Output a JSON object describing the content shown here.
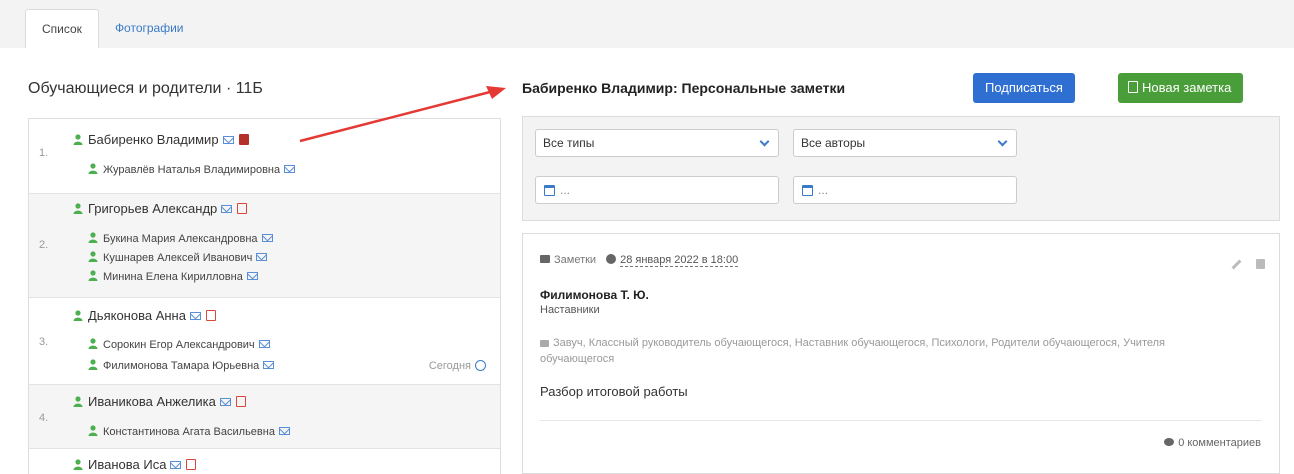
{
  "tabs": [
    {
      "label": "Список",
      "active": true
    },
    {
      "label": "Фотографии",
      "active": false
    }
  ],
  "left_title": "Обучающиеся и родители · 11Б",
  "right_title": "Бабиренко Владимир: Персональные заметки",
  "buttons": {
    "subscribe": "Подписаться",
    "new_note": "Новая заметка"
  },
  "students": [
    {
      "num": "1.",
      "name": "Бабиренко Владимир",
      "parents": [
        "Журавлёв Наталья Владимировна"
      ]
    },
    {
      "num": "2.",
      "name": "Григорьев Александр",
      "parents": [
        "Букина Мария Александровна",
        "Кушнарев Алексей Иванович",
        "Минина Елена Кирилловна"
      ]
    },
    {
      "num": "3.",
      "name": "Дьяконова Анна",
      "parents": [
        "Сорокин Егор Александрович",
        "Филимонова Тамара Юрьевна"
      ],
      "today": "Сегодня"
    },
    {
      "num": "4.",
      "name": "Иваникова Анжелика",
      "parents": [
        "Константинова Агата Васильевна"
      ]
    },
    {
      "num": "",
      "name": "Иванова Иса",
      "parents": []
    }
  ],
  "filters": {
    "type": "Все типы",
    "author": "Все авторы",
    "date_from_placeholder": "...",
    "date_to_placeholder": "..."
  },
  "note": {
    "category": "Заметки",
    "date": "28 января 2022 в 18:00",
    "author": "Филимонова Т. Ю.",
    "role": "Наставники",
    "access": "Завуч, Классный руководитель обучающегося, Наставник обучающегося, Психологи, Родители обучающегося, Учителя обучающегося",
    "text": "Разбор итоговой работы",
    "comments": "0 комментариев"
  },
  "colors": {
    "accent": "#2f6fd1",
    "success": "#4a9e3a",
    "person": "#4caf50",
    "note_icon": "#d9463b",
    "annotation_arrow": "#e53935"
  }
}
